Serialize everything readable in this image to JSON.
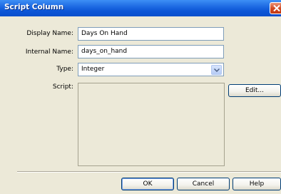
{
  "dialog": {
    "title": "Script Column",
    "close_icon": "close-icon"
  },
  "form": {
    "display_name_label": "Display Name:",
    "display_name_value": "Days On Hand",
    "internal_name_label": "Internal Name:",
    "internal_name_value": "days_on_hand",
    "type_label": "Type:",
    "type_value": "Integer",
    "script_label": "Script:",
    "script_value": ""
  },
  "buttons": {
    "edit": "Edit...",
    "ok": "OK",
    "cancel": "Cancel",
    "help": "Help"
  },
  "colors": {
    "titlebar": "#0b54d6",
    "dialog_bg": "#ece9d8",
    "close_button": "#d0461f"
  }
}
